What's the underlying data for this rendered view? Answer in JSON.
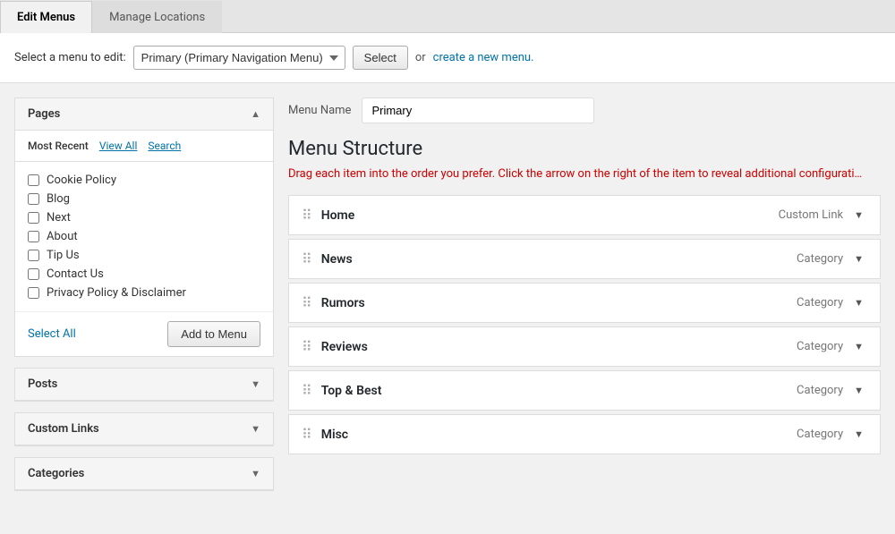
{
  "tabs": [
    {
      "id": "edit-menus",
      "label": "Edit Menus",
      "active": true
    },
    {
      "id": "manage-locations",
      "label": "Manage Locations",
      "active": false
    }
  ],
  "select_bar": {
    "label": "Select a menu to edit:",
    "selected_menu": "Primary (Primary Navigation Menu)",
    "menu_options": [
      "Primary (Primary Navigation Menu)"
    ],
    "select_button_label": "Select",
    "or_text": "or",
    "create_link_text": "create a new menu",
    "create_link_suffix": "."
  },
  "left_panel": {
    "pages": {
      "title": "Pages",
      "tabs": [
        {
          "id": "most-recent",
          "label": "Most Recent",
          "active": true,
          "is_link": false
        },
        {
          "id": "view-all",
          "label": "View All",
          "active": false,
          "is_link": true
        },
        {
          "id": "search",
          "label": "Search",
          "active": false,
          "is_link": true
        }
      ],
      "items": [
        {
          "id": "cookie-policy",
          "label": "Cookie Policy",
          "checked": false
        },
        {
          "id": "blog",
          "label": "Blog",
          "checked": false
        },
        {
          "id": "next",
          "label": "Next",
          "checked": false
        },
        {
          "id": "about",
          "label": "About",
          "checked": false
        },
        {
          "id": "tip-us",
          "label": "Tip Us",
          "checked": false
        },
        {
          "id": "contact-us",
          "label": "Contact Us",
          "checked": false
        },
        {
          "id": "privacy-policy",
          "label": "Privacy Policy & Disclaimer",
          "checked": false
        }
      ],
      "select_all_label": "Select All",
      "add_to_menu_label": "Add to Menu"
    },
    "collapsed_panels": [
      {
        "id": "posts",
        "label": "Posts"
      },
      {
        "id": "custom-links",
        "label": "Custom Links"
      },
      {
        "id": "categories",
        "label": "Categories"
      }
    ]
  },
  "right_panel": {
    "menu_name_label": "Menu Name",
    "menu_name_value": "Primary",
    "structure_title": "Menu Structure",
    "structure_hint": "Drag each item into the order you prefer. Click the arrow on the right of the item to reveal additional configurati…",
    "menu_items": [
      {
        "id": "home",
        "name": "Home",
        "type": "Custom Link"
      },
      {
        "id": "news",
        "name": "News",
        "type": "Category"
      },
      {
        "id": "rumors",
        "name": "Rumors",
        "type": "Category"
      },
      {
        "id": "reviews",
        "name": "Reviews",
        "type": "Category"
      },
      {
        "id": "top-best",
        "name": "Top & Best",
        "type": "Category"
      },
      {
        "id": "misc",
        "name": "Misc",
        "type": "Category"
      }
    ]
  }
}
